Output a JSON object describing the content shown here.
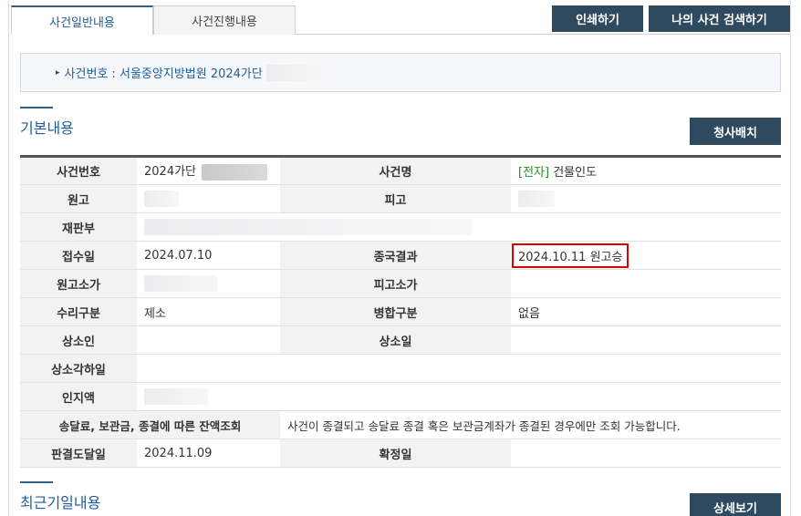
{
  "tabs": [
    {
      "label": "사건일반내용",
      "active": true
    },
    {
      "label": "사건진행내용",
      "active": false
    }
  ],
  "buttons": {
    "print": "인쇄하기",
    "my_case_search": "나의 사건 검색하기",
    "seating": "청사배치",
    "detail": "상세보기"
  },
  "case_number_line": "사건번호 : 서울중앙지방법원 2024가단",
  "sections": {
    "basic": "기본내용",
    "recent": "최근기일내용"
  },
  "table": {
    "case_no_label": "사건번호",
    "case_no_value": "2024가단",
    "case_name_label": "사건명",
    "case_name_tag": "[전자]",
    "case_name_value": "건물인도",
    "plaintiff_label": "원고",
    "defendant_label": "피고",
    "court_dept_label": "재판부",
    "filing_date_label": "접수일",
    "filing_date_value": "2024.07.10",
    "final_result_label": "종국결과",
    "final_result_value": "2024.10.11 원고승",
    "plaintiff_amount_label": "원고소가",
    "defendant_amount_label": "피고소가",
    "category_label": "수리구분",
    "category_value": "제소",
    "merge_label": "병합구분",
    "merge_value": "없음",
    "appellant_label": "상소인",
    "appeal_date_label": "상소일",
    "appeal_dismiss_label": "상소각하일",
    "stamp_label": "인지액",
    "balance_label": "송달료, 보관금, 종결에 따른 잔액조회",
    "balance_value": "사건이 종결되고 송달료 종결 혹은 보관금계좌가 종결된 경우에만 조회 가능합니다.",
    "judgment_delivery_label": "판결도달일",
    "judgment_delivery_value": "2024.11.09",
    "finalized_label": "확정일"
  }
}
